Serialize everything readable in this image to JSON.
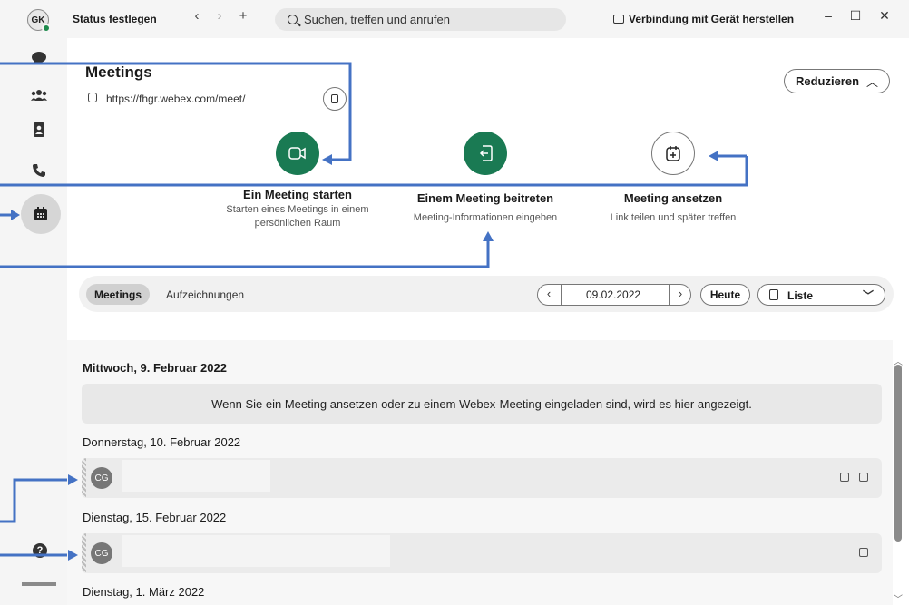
{
  "titlebar": {
    "avatar_initials": "GK",
    "status_label": "Status festlegen",
    "search_placeholder": "Suchen, treffen und anrufen",
    "connect_label": "Verbindung mit Gerät herstellen"
  },
  "sidebar": {
    "items": [
      {
        "name": "messaging-icon"
      },
      {
        "name": "teams-icon"
      },
      {
        "name": "contacts-icon"
      },
      {
        "name": "calling-icon"
      },
      {
        "name": "meetings-icon",
        "active": true
      }
    ],
    "help": "?"
  },
  "header": {
    "title": "Meetings",
    "url": "https://fhgr.webex.com/meet/",
    "reduce_label": "Reduzieren"
  },
  "actions": [
    {
      "title": "Ein Meeting starten",
      "sub1": "Starten eines Meetings in einem",
      "sub2": "persönlichen Raum"
    },
    {
      "title": "Einem Meeting beitreten",
      "sub1": "Meeting-Informationen eingeben"
    },
    {
      "title": "Meeting ansetzen",
      "sub1": "Link teilen und später treffen"
    }
  ],
  "toolbar": {
    "tab_meetings": "Meetings",
    "tab_recordings": "Aufzeichnungen",
    "date": "09.02.2022",
    "today": "Heute",
    "view": "Liste"
  },
  "list": {
    "days": [
      {
        "label": "Mittwoch, 9. Februar 2022",
        "empty_text": "Wenn Sie ein Meeting ansetzen oder zu einem Webex-Meeting eingeladen sind, wird es hier angezeigt."
      },
      {
        "label": "Donnerstag, 10. Februar 2022",
        "avatar": "CG"
      },
      {
        "label": "Dienstag, 15. Februar 2022",
        "avatar": "CG"
      },
      {
        "label": "Dienstag, 1. März 2022"
      }
    ]
  },
  "colors": {
    "accent_green": "#1a7a53",
    "annotation_blue": "#4472c4"
  }
}
